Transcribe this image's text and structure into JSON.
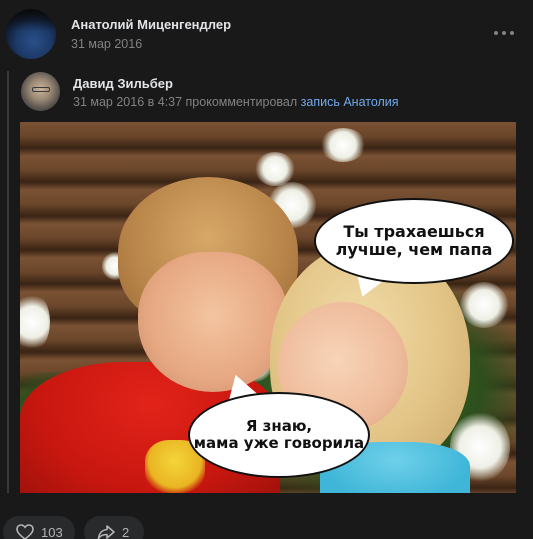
{
  "post": {
    "author": "Анатолий Миценгендлер",
    "date": "31 мар 2016",
    "menu_icon": "more-horizontal-icon"
  },
  "comment": {
    "author": "Давид Зильбер",
    "meta": "31 мар 2016 в 4:37 прокомментировал ",
    "link": "запись Анатолия"
  },
  "photo": {
    "bubble_1": "Ты трахаешься\nлучше, чем папа",
    "bubble_2": "Я знаю,\nмама уже говорила"
  },
  "actions": {
    "likes": "103",
    "shares": "2",
    "like_icon": "heart-icon",
    "share_icon": "share-arrow-icon"
  },
  "colors": {
    "background": "#19191a",
    "link": "#71aaeb",
    "muted": "#828282"
  }
}
